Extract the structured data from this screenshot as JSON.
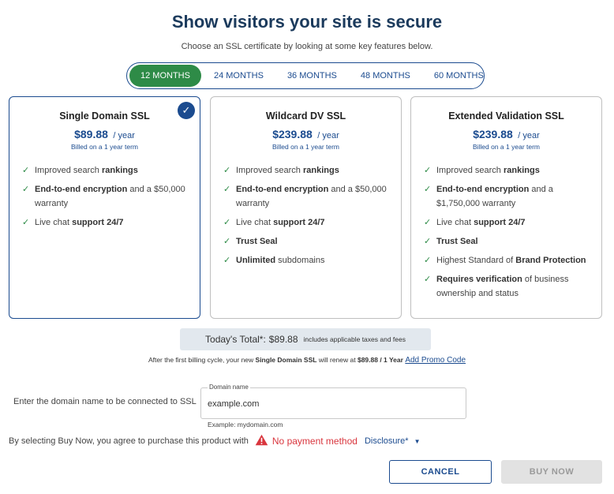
{
  "header": {
    "title": "Show visitors your site is secure",
    "subtitle": "Choose an SSL certificate by looking at some key features below."
  },
  "terms": [
    {
      "label": "12 MONTHS",
      "active": true
    },
    {
      "label": "24 MONTHS",
      "active": false
    },
    {
      "label": "36 MONTHS",
      "active": false
    },
    {
      "label": "48 MONTHS",
      "active": false
    },
    {
      "label": "60 MONTHS",
      "active": false
    }
  ],
  "plans": [
    {
      "name": "Single Domain SSL",
      "price": "$89.88",
      "per": "/ year",
      "billed": "Billed on a 1 year term",
      "selected": true,
      "features": [
        [
          {
            "t": "Improved search "
          },
          {
            "t": "rankings",
            "b": true
          }
        ],
        [
          {
            "t": "End-to-end encryption",
            "b": true
          },
          {
            "t": " and a $50,000 warranty"
          }
        ],
        [
          {
            "t": "Live chat "
          },
          {
            "t": "support 24/7",
            "b": true
          }
        ]
      ]
    },
    {
      "name": "Wildcard DV SSL",
      "price": "$239.88",
      "per": "/ year",
      "billed": "Billed on a 1 year term",
      "selected": false,
      "features": [
        [
          {
            "t": "Improved search "
          },
          {
            "t": "rankings",
            "b": true
          }
        ],
        [
          {
            "t": "End-to-end encryption",
            "b": true
          },
          {
            "t": " and a $50,000 warranty"
          }
        ],
        [
          {
            "t": "Live chat "
          },
          {
            "t": "support 24/7",
            "b": true
          }
        ],
        [
          {
            "t": "Trust Seal",
            "b": true
          }
        ],
        [
          {
            "t": "Unlimited",
            "b": true
          },
          {
            "t": " subdomains"
          }
        ]
      ]
    },
    {
      "name": "Extended Validation SSL",
      "price": "$239.88",
      "per": "/ year",
      "billed": "Billed on a 1 year term",
      "selected": false,
      "features": [
        [
          {
            "t": "Improved search "
          },
          {
            "t": "rankings",
            "b": true
          }
        ],
        [
          {
            "t": "End-to-end encryption",
            "b": true
          },
          {
            "t": " and a $1,750,000 warranty"
          }
        ],
        [
          {
            "t": "Live chat "
          },
          {
            "t": "support 24/7",
            "b": true
          }
        ],
        [
          {
            "t": "Trust Seal",
            "b": true
          }
        ],
        [
          {
            "t": "Highest Standard of "
          },
          {
            "t": "Brand Protection",
            "b": true
          }
        ],
        [
          {
            "t": "Requires verification",
            "b": true
          },
          {
            "t": " of business ownership and status"
          }
        ]
      ]
    }
  ],
  "total": {
    "label": "Today's Total*:",
    "value": "$89.88",
    "note": "includes applicable taxes and fees"
  },
  "renewal": {
    "prefix": "After the first billing cycle, your new ",
    "product": "Single Domain SSL",
    "middle": " will renew at ",
    "price": "$89.88 / 1 Year",
    "promo_link": "Add Promo Code"
  },
  "domain": {
    "label": "Enter the domain name to be connected to SSL",
    "legend": "Domain name",
    "value": "example.com",
    "example": "Example: mydomain.com"
  },
  "consent": {
    "text": "By selecting Buy Now, you agree to purchase this product with",
    "payment_status": "No payment method",
    "disclosure": "Disclosure*"
  },
  "actions": {
    "cancel": "CANCEL",
    "buy": "BUY NOW"
  },
  "colors": {
    "brand": "#1b4b8f",
    "active_tab": "#2e8b47",
    "check": "#2e8b47",
    "warning": "#d9363e"
  }
}
